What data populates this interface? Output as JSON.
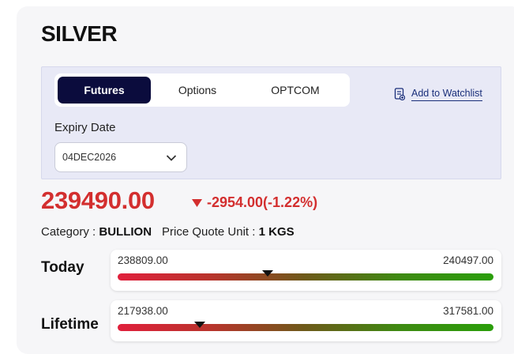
{
  "title": "SILVER",
  "tabs": [
    {
      "label": "Futures",
      "active": true
    },
    {
      "label": "Options",
      "active": false
    },
    {
      "label": "OPTCOM",
      "active": false
    }
  ],
  "watchlist": {
    "label": "Add to Watchlist",
    "icon": "watchlist-doc-icon"
  },
  "expiry": {
    "label": "Expiry Date",
    "value": "04DEC2026"
  },
  "price": {
    "value": "239490.00",
    "change": "-2954.00(-1.22%)",
    "direction_icon": "down-triangle-icon",
    "color": "#d32f2f"
  },
  "meta": {
    "category_label": "Category :",
    "category_value": "BULLION",
    "unit_label": "Price Quote Unit :",
    "unit_value": "1 KGS"
  },
  "ranges": {
    "today": {
      "label": "Today",
      "low": "238809.00",
      "high": "240497.00",
      "current_fraction": 0.4
    },
    "lifetime": {
      "label": "Lifetime",
      "low": "217938.00",
      "high": "317581.00",
      "current_fraction": 0.218
    }
  },
  "colors": {
    "accent": "#0b0c3d",
    "negative": "#d32f2f",
    "link": "#1a2f7a"
  }
}
